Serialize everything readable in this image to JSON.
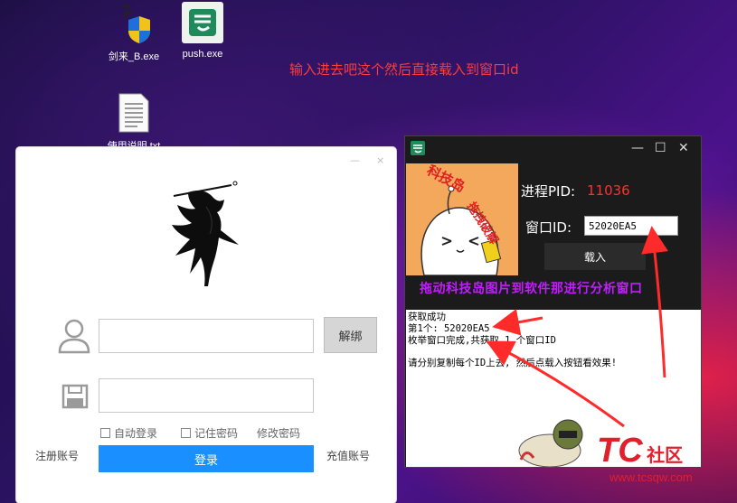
{
  "desktop": {
    "icons": [
      {
        "label": "剑来_B.exe"
      },
      {
        "label": "push.exe"
      },
      {
        "label": "使用说明.txt"
      }
    ],
    "annotation": "输入进去吧这个然后直接载入到窗口id"
  },
  "login_window": {
    "minimize_label": "—",
    "close_label": "×",
    "unlock_button": "解绑",
    "username_value": "",
    "password_value": "",
    "remember_login_label": "自动登录",
    "remember_password_label": "记住密码",
    "change_password_label": "修改密码",
    "register_label": "注册账号",
    "login_button": "登录",
    "recharge_label": "充值账号"
  },
  "tool_window": {
    "minimize_label": "—",
    "maximize_label": "☐",
    "close_label": "✕",
    "banner_text_1": "科技岛",
    "banner_text_2": "拖拽破解",
    "pid_label": "进程PID:",
    "pid_value": "11036",
    "window_id_label": "窗口ID:",
    "window_id_value": "52020EA5",
    "load_button": "载入",
    "drag_hint": "拖动科技岛图片到软件那进行分析窗口",
    "log_lines": [
      "获取成功",
      "第1个: 52020EA5",
      "枚举窗口完成,共获取 1 个窗口ID",
      "",
      "请分别复制每个ID上去, 然后点载入按钮看效果!"
    ]
  },
  "watermark": {
    "brand": "TC",
    "suffix": "社区",
    "url": "www.tcsqw.com"
  },
  "colors": {
    "accent_blue": "#1a8fff",
    "pid_red": "#ff3030",
    "hint_purple": "#c21cff",
    "annotation_red": "#ff3b3b"
  }
}
